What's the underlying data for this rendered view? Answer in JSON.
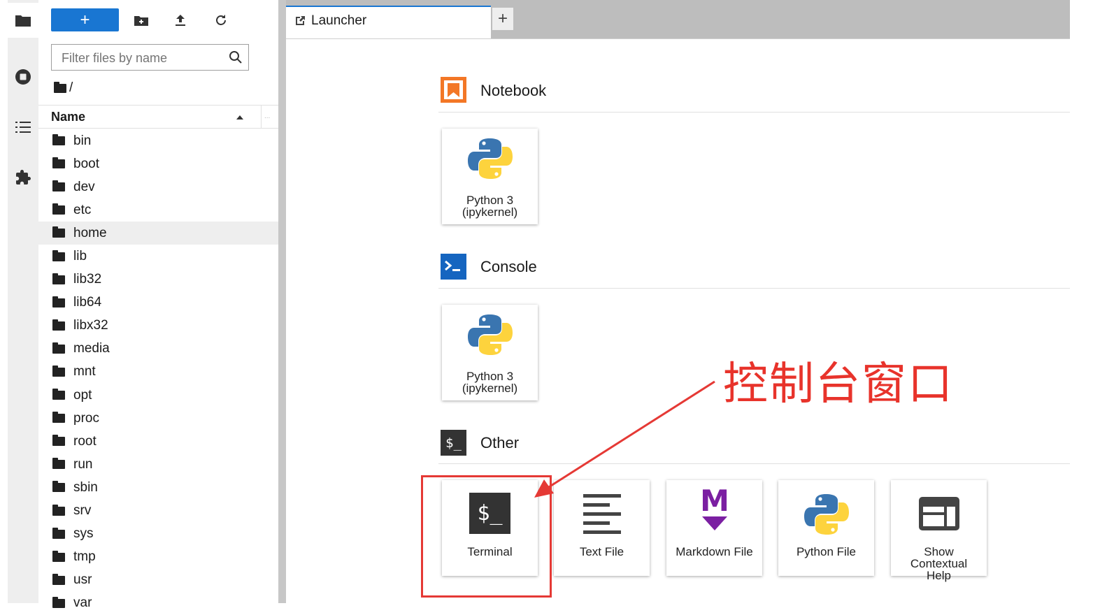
{
  "activity_bar": {
    "items": [
      "folder-icon",
      "stop-circle-icon",
      "list-icon",
      "puzzle-icon"
    ]
  },
  "file_browser": {
    "new_label": "+",
    "filter_placeholder": "Filter files by name",
    "breadcrumb": "/",
    "column_name": "Name",
    "column_more": "...",
    "rows": [
      "bin",
      "boot",
      "dev",
      "etc",
      "home",
      "lib",
      "lib32",
      "lib64",
      "libx32",
      "media",
      "mnt",
      "opt",
      "proc",
      "root",
      "run",
      "sbin",
      "srv",
      "sys",
      "tmp",
      "usr",
      "var"
    ],
    "selected": "home"
  },
  "tabs": {
    "launcher_label": "Launcher",
    "add_label": "+"
  },
  "launcher": {
    "notebook_title": "Notebook",
    "console_title": "Console",
    "other_title": "Other",
    "notebook_card": {
      "line1": "Python 3",
      "line2": "(ipykernel)"
    },
    "console_card": {
      "line1": "Python 3",
      "line2": "(ipykernel)"
    },
    "other_cards": [
      {
        "label": "Terminal"
      },
      {
        "label": "Text File"
      },
      {
        "label": "Markdown File"
      },
      {
        "label": "Python File"
      },
      {
        "line1": "Show",
        "line2": "Contextual",
        "line3": "Help"
      }
    ],
    "other_icon_text": "$_",
    "terminal_icon_text": "$_",
    "markdown_icon_text": "M"
  },
  "annotation": {
    "text": "控制台窗口",
    "color": "#e8332b"
  },
  "colors": {
    "accent": "#1976d2",
    "notebook": "#f37726",
    "console": "#0d47a1"
  }
}
